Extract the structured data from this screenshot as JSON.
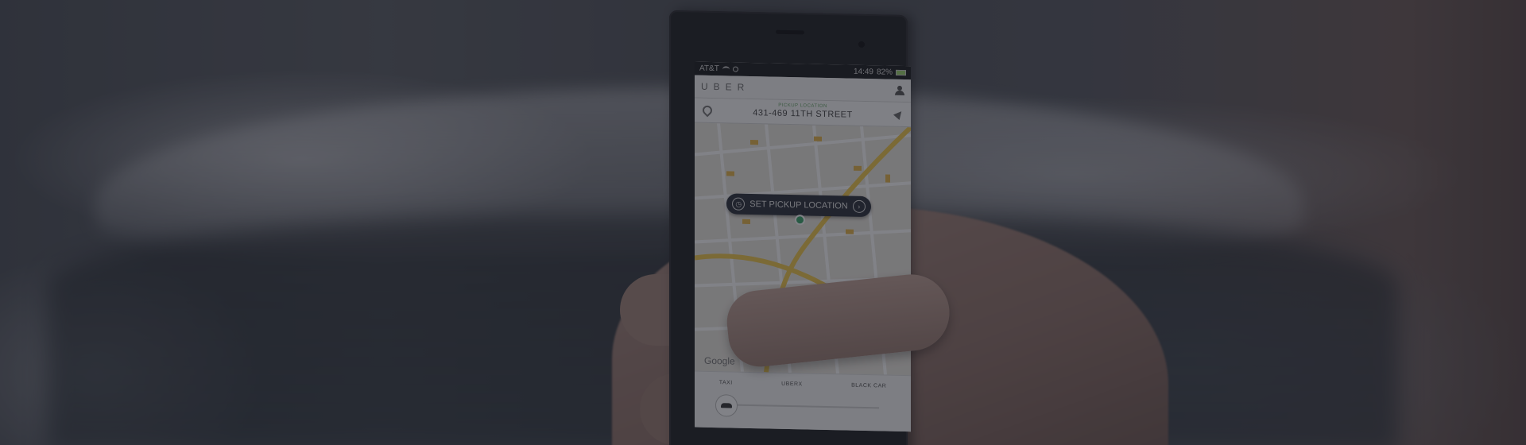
{
  "phone": {
    "status": {
      "carrier": "AT&T",
      "time": "14:49",
      "battery": "82%"
    },
    "app": {
      "logo": "UBER"
    },
    "pickup": {
      "label": "PICKUP LOCATION",
      "address": "431-469 11TH STREET"
    },
    "map": {
      "cta": "SET PICKUP LOCATION",
      "attribution": "Google"
    },
    "tabs": [
      "TAXI",
      "UBERX",
      "BLACK CAR"
    ]
  },
  "icons": [
    "pin-icon",
    "locate-icon",
    "account-icon",
    "clock-icon",
    "arrow-circle-icon",
    "car-icon",
    "wifi-icon",
    "battery-icon"
  ],
  "colors": {
    "overlay": "#191c24",
    "map_road": "#f2c94c",
    "pill": "#2a2f3a",
    "pin": "#3aa66b"
  }
}
